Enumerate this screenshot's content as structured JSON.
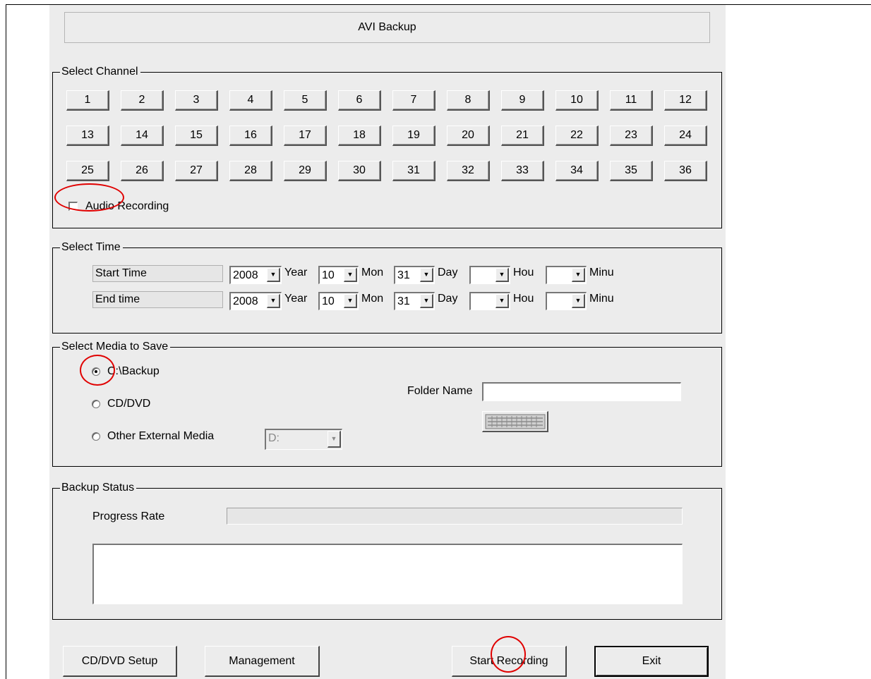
{
  "window": {
    "title": "AVI Backup"
  },
  "select_channel": {
    "legend": "Select Channel",
    "channels": [
      "1",
      "2",
      "3",
      "4",
      "5",
      "6",
      "7",
      "8",
      "9",
      "10",
      "11",
      "12",
      "13",
      "14",
      "15",
      "16",
      "17",
      "18",
      "19",
      "20",
      "21",
      "22",
      "23",
      "24",
      "25",
      "26",
      "27",
      "28",
      "29",
      "30",
      "31",
      "32",
      "33",
      "34",
      "35",
      "36"
    ],
    "audio_label": "Audio Recording",
    "audio_checked": false
  },
  "select_time": {
    "legend": "Select Time",
    "rows": [
      {
        "label": "Start Time",
        "year": "2008",
        "year_unit": "Year",
        "month": "10",
        "month_unit": "Mon",
        "day": "31",
        "day_unit": "Day",
        "hour": "",
        "hour_unit": "Hou",
        "minute": "",
        "minute_unit": "Minu"
      },
      {
        "label": "End time",
        "year": "2008",
        "year_unit": "Year",
        "month": "10",
        "month_unit": "Mon",
        "day": "31",
        "day_unit": "Day",
        "hour": "",
        "hour_unit": "Hou",
        "minute": "",
        "minute_unit": "Minu"
      }
    ]
  },
  "select_media": {
    "legend": "Select Media to Save",
    "options": [
      {
        "label": "C:\\Backup",
        "selected": true
      },
      {
        "label": "CD/DVD",
        "selected": false
      },
      {
        "label": "Other External Media",
        "selected": false
      }
    ],
    "drive_value": "D:",
    "folder_label": "Folder Name",
    "folder_value": ""
  },
  "backup_status": {
    "legend": "Backup Status",
    "progress_label": "Progress Rate",
    "progress_percent": 0,
    "log_text": ""
  },
  "buttons": {
    "cd_dvd_setup": "CD/DVD Setup",
    "management": "Management",
    "start_recording": "Start Recording",
    "exit": "Exit"
  },
  "colors": {
    "panel": "#ececec",
    "annotation": "#e00000",
    "progress": "#2a4fd0"
  }
}
